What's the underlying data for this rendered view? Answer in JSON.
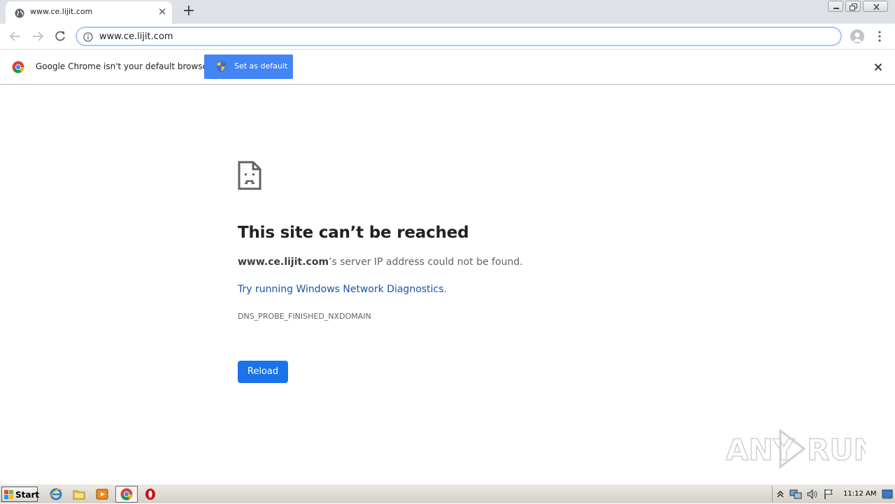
{
  "browser": {
    "tab_title": "www.ce.lijit.com",
    "url": "www.ce.lijit.com"
  },
  "infobar": {
    "message": "Google Chrome isn't your default browser",
    "button_label": "Set as default"
  },
  "error_page": {
    "title": "This site can’t be reached",
    "host": "www.ce.lijit.com",
    "description_rest": "’s server IP address could not be found.",
    "diagnostics_link": "Try running Windows Network Diagnostics.",
    "error_code": "DNS_PROBE_FINISHED_NXDOMAIN",
    "reload_label": "Reload"
  },
  "watermark": "ANY RUN",
  "taskbar": {
    "start_label": "Start",
    "clock": "11:12 AM"
  },
  "colors": {
    "accent": "#1a73e8",
    "infobar_button": "#4285f4",
    "link": "#1a53a8"
  },
  "icons": [
    "globe-icon",
    "close-icon",
    "new-tab-icon",
    "back-icon",
    "forward-icon",
    "reload-icon",
    "info-icon",
    "profile-icon",
    "menu-icon",
    "chrome-logo-icon",
    "shield-icon",
    "sad-document-icon",
    "windows-flag-icon",
    "ie-icon",
    "folder-icon",
    "media-player-icon",
    "chrome-icon",
    "opera-icon"
  ]
}
